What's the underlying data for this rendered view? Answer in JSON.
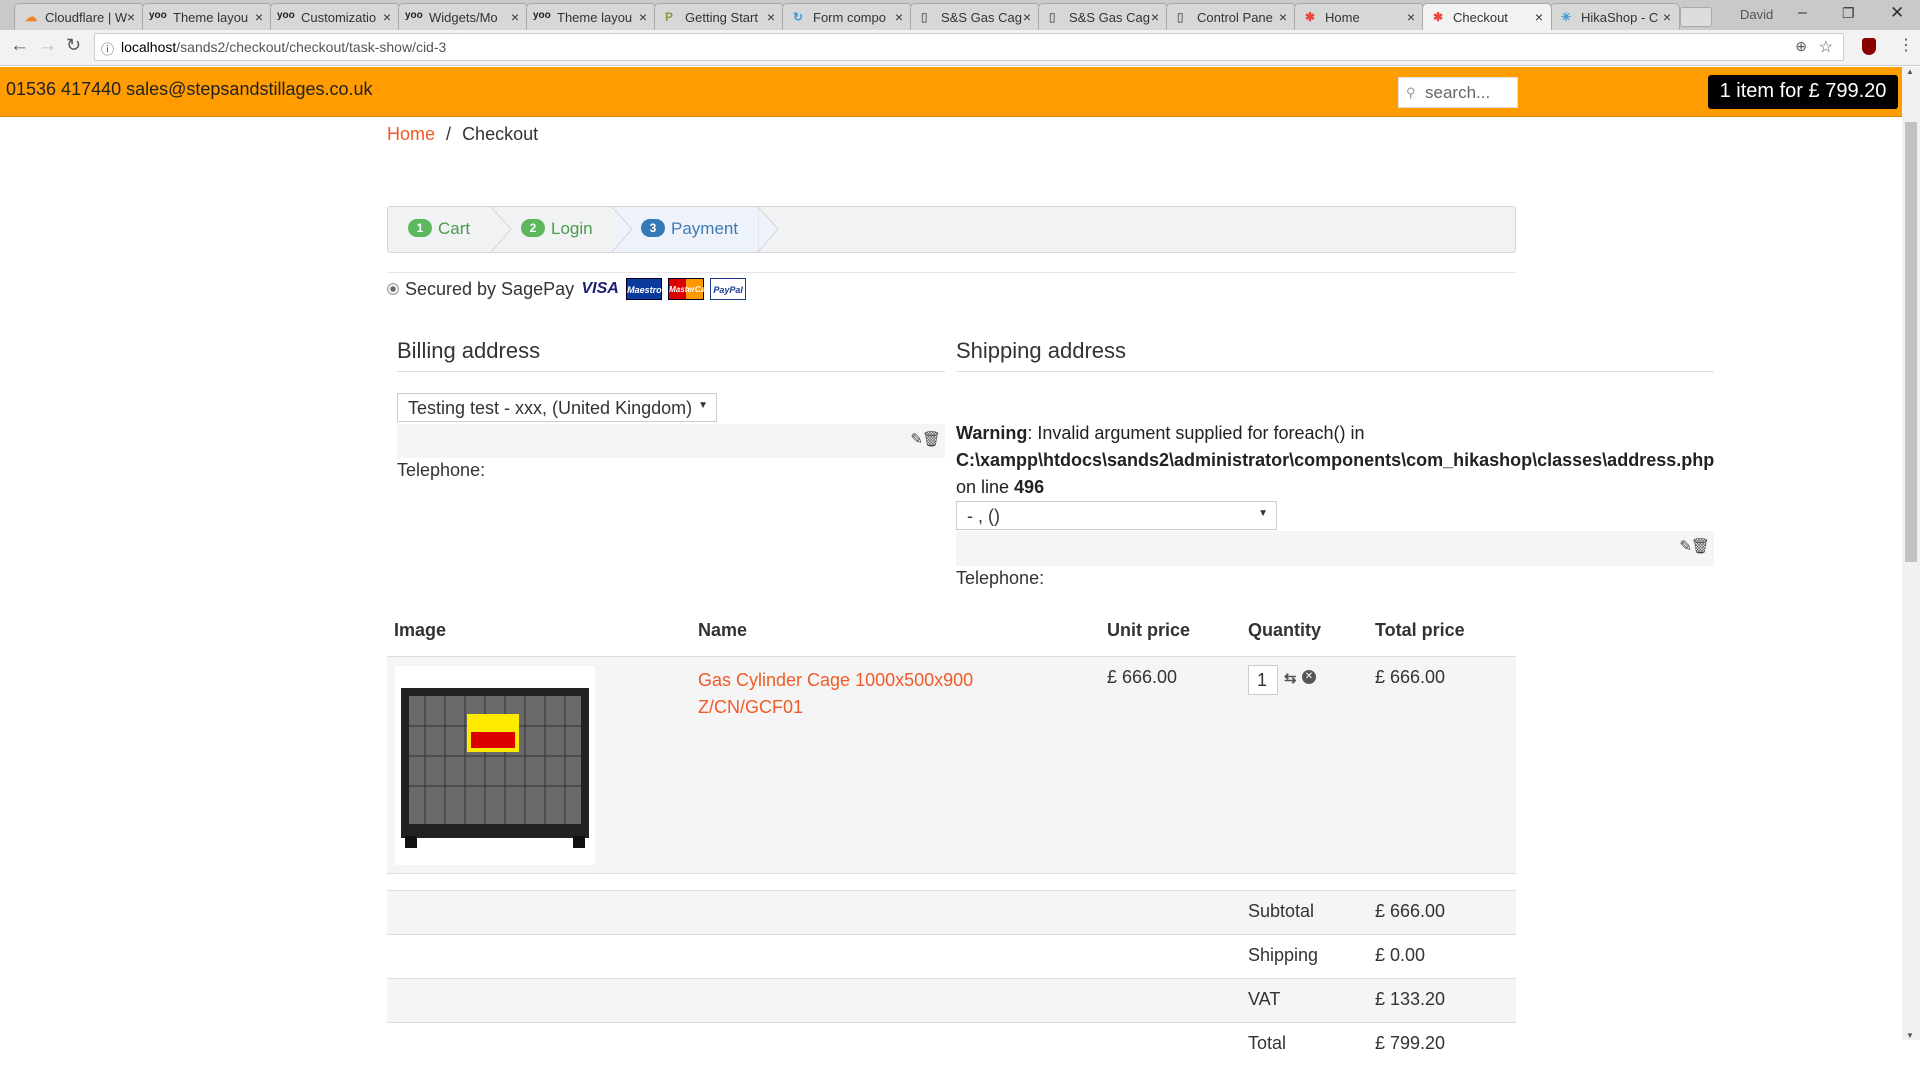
{
  "browser": {
    "tabs": [
      {
        "label": "Cloudflare | W",
        "icon": "cloud-icon"
      },
      {
        "label": "Theme layou",
        "icon": "yoo-icon"
      },
      {
        "label": "Customizatio",
        "icon": "yoo-icon"
      },
      {
        "label": "Widgets/Mo",
        "icon": "yoo-icon"
      },
      {
        "label": "Theme layou",
        "icon": "yoo-icon"
      },
      {
        "label": "Getting Start",
        "icon": "p-icon"
      },
      {
        "label": "Form compo",
        "icon": "spinner-icon"
      },
      {
        "label": "S&S Gas Cag",
        "icon": "page-icon"
      },
      {
        "label": "S&S Gas Cag",
        "icon": "page-icon"
      },
      {
        "label": "Control Pane",
        "icon": "page-icon"
      },
      {
        "label": "Home",
        "icon": "joomla-icon"
      },
      {
        "label": "Checkout",
        "icon": "joomla-icon",
        "active": true
      },
      {
        "label": "HikaShop - C",
        "icon": "hikashop-icon"
      }
    ],
    "profile": "David",
    "url_host": "localhost",
    "url_path": "/sands2/checkout/checkout/task-show/cid-3"
  },
  "header": {
    "contact": "01536 417440 sales@stepsandstillages.co.uk",
    "search_placeholder": "search...",
    "cart": "1 item for £ 799.20",
    "accent": "#ff9c00"
  },
  "breadcrumb": {
    "home": "Home",
    "sep": "/",
    "current": "Checkout"
  },
  "steps": [
    {
      "num": "1",
      "label": "Cart"
    },
    {
      "num": "2",
      "label": "Login"
    },
    {
      "num": "3",
      "label": "Payment",
      "current": true
    }
  ],
  "payment": {
    "label": "Secured by SagePay",
    "cards": [
      "VISA",
      "Maestro",
      "MasterCard",
      "PayPal"
    ]
  },
  "billing": {
    "title": "Billing address",
    "selected": "Testing test - xxx, (United Kingdom)",
    "telephone": "Telephone:"
  },
  "shipping": {
    "title": "Shipping address",
    "warning_label": "Warning",
    "warning_text": ": Invalid argument supplied for foreach() in",
    "warning_path": "C:\\xampp\\htdocs\\sands2\\administrator\\components\\com_hikashop\\classes\\address.php",
    "warning_online": "on line ",
    "warning_line": "496",
    "selected": "- , ()",
    "telephone": "Telephone:"
  },
  "cart_table": {
    "headers": [
      "Image",
      "Name",
      "Unit price",
      "Quantity",
      "Total price"
    ],
    "items": [
      {
        "name": "Gas Cylinder Cage 1000x500x900",
        "code": "Z/CN/GCF01",
        "unit_price": "£ 666.00",
        "quantity": "1",
        "total": "£ 666.00"
      }
    ],
    "totals": [
      {
        "label": "Subtotal",
        "value": "£ 666.00"
      },
      {
        "label": "Shipping",
        "value": "£ 0.00"
      },
      {
        "label": "VAT",
        "value": "£ 133.20"
      },
      {
        "label": "Total",
        "value": "£ 799.20"
      }
    ]
  }
}
